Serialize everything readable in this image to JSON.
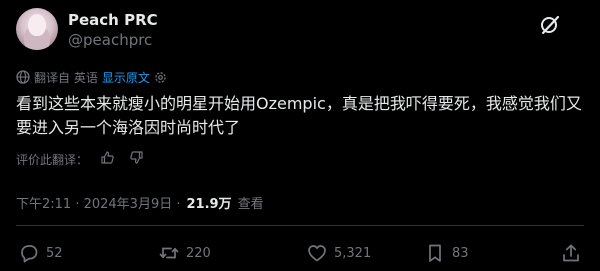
{
  "author": {
    "name": "Peach PRC",
    "handle": "@peachprc"
  },
  "translation": {
    "notice": "翻译自 英语",
    "show_original": "显示原文"
  },
  "tweet": {
    "text": "看到这些本来就瘦小的明星开始用Ozempic，真是把我吓得要死，我感觉我们又要进入另一个海洛因时尚时代了"
  },
  "rate_translation": {
    "label": "评价此翻译："
  },
  "meta": {
    "timestamp": "下午2:11 · 2024年3月9日 ·",
    "views": "21.9万",
    "views_suffix": "查看"
  },
  "actions": {
    "replies": "52",
    "reposts": "220",
    "likes": "5,321",
    "bookmarks": "83"
  },
  "colors": {
    "background": "#000000",
    "text": "#e7e9ea",
    "muted": "#71767b",
    "link": "#1d9bf0",
    "divider": "#2f3336"
  }
}
